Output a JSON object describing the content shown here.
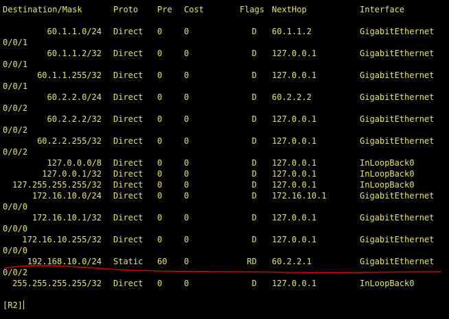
{
  "header": {
    "destination": "Destination/Mask",
    "proto": "Proto",
    "pre": "Pre",
    "cost": "Cost",
    "flags": "Flags",
    "nexthop": "NextHop",
    "interface": "Interface"
  },
  "routes": [
    {
      "dest": "60.1.1.0/24",
      "proto": "Direct",
      "pre": "0",
      "cost": "0",
      "flags": "D",
      "nexthop": "60.1.1.2",
      "iface": "GigabitEthernet",
      "iface_cont": "0/0/1"
    },
    {
      "dest": "60.1.1.2/32",
      "proto": "Direct",
      "pre": "0",
      "cost": "0",
      "flags": "D",
      "nexthop": "127.0.0.1",
      "iface": "GigabitEthernet",
      "iface_cont": "0/0/1"
    },
    {
      "dest": "60.1.1.255/32",
      "proto": "Direct",
      "pre": "0",
      "cost": "0",
      "flags": "D",
      "nexthop": "127.0.0.1",
      "iface": "GigabitEthernet",
      "iface_cont": "0/0/1"
    },
    {
      "dest": "60.2.2.0/24",
      "proto": "Direct",
      "pre": "0",
      "cost": "0",
      "flags": "D",
      "nexthop": "60.2.2.2",
      "iface": "GigabitEthernet",
      "iface_cont": "0/0/2"
    },
    {
      "dest": "60.2.2.2/32",
      "proto": "Direct",
      "pre": "0",
      "cost": "0",
      "flags": "D",
      "nexthop": "127.0.0.1",
      "iface": "GigabitEthernet",
      "iface_cont": "0/0/2"
    },
    {
      "dest": "60.2.2.255/32",
      "proto": "Direct",
      "pre": "0",
      "cost": "0",
      "flags": "D",
      "nexthop": "127.0.0.1",
      "iface": "GigabitEthernet",
      "iface_cont": "0/0/2"
    },
    {
      "dest": "127.0.0.0/8",
      "proto": "Direct",
      "pre": "0",
      "cost": "0",
      "flags": "D",
      "nexthop": "127.0.0.1",
      "iface": "InLoopBack0",
      "iface_cont": ""
    },
    {
      "dest": "127.0.0.1/32",
      "proto": "Direct",
      "pre": "0",
      "cost": "0",
      "flags": "D",
      "nexthop": "127.0.0.1",
      "iface": "InLoopBack0",
      "iface_cont": ""
    },
    {
      "dest": "127.255.255.255/32",
      "proto": "Direct",
      "pre": "0",
      "cost": "0",
      "flags": "D",
      "nexthop": "127.0.0.1",
      "iface": "InLoopBack0",
      "iface_cont": ""
    },
    {
      "dest": "172.16.10.0/24",
      "proto": "Direct",
      "pre": "0",
      "cost": "0",
      "flags": "D",
      "nexthop": "172.16.10.1",
      "iface": "GigabitEthernet",
      "iface_cont": "0/0/0"
    },
    {
      "dest": "172.16.10.1/32",
      "proto": "Direct",
      "pre": "0",
      "cost": "0",
      "flags": "D",
      "nexthop": "127.0.0.1",
      "iface": "GigabitEthernet",
      "iface_cont": "0/0/0"
    },
    {
      "dest": "172.16.10.255/32",
      "proto": "Direct",
      "pre": "0",
      "cost": "0",
      "flags": "D",
      "nexthop": "127.0.0.1",
      "iface": "GigabitEthernet",
      "iface_cont": "0/0/0"
    },
    {
      "dest": "192.168.10.0/24",
      "proto": "Static",
      "pre": "60",
      "cost": "0",
      "flags": "RD",
      "nexthop": "60.2.2.1",
      "iface": "GigabitEthernet",
      "iface_cont": "0/0/2"
    },
    {
      "dest": "255.255.255.255/32",
      "proto": "Direct",
      "pre": "0",
      "cost": "0",
      "flags": "D",
      "nexthop": "127.0.0.1",
      "iface": "InLoopBack0",
      "iface_cont": ""
    }
  ],
  "prompt": "[R2]",
  "colors": {
    "background": "#000000",
    "text": "#e8e85a",
    "annotation": "#d40000"
  }
}
